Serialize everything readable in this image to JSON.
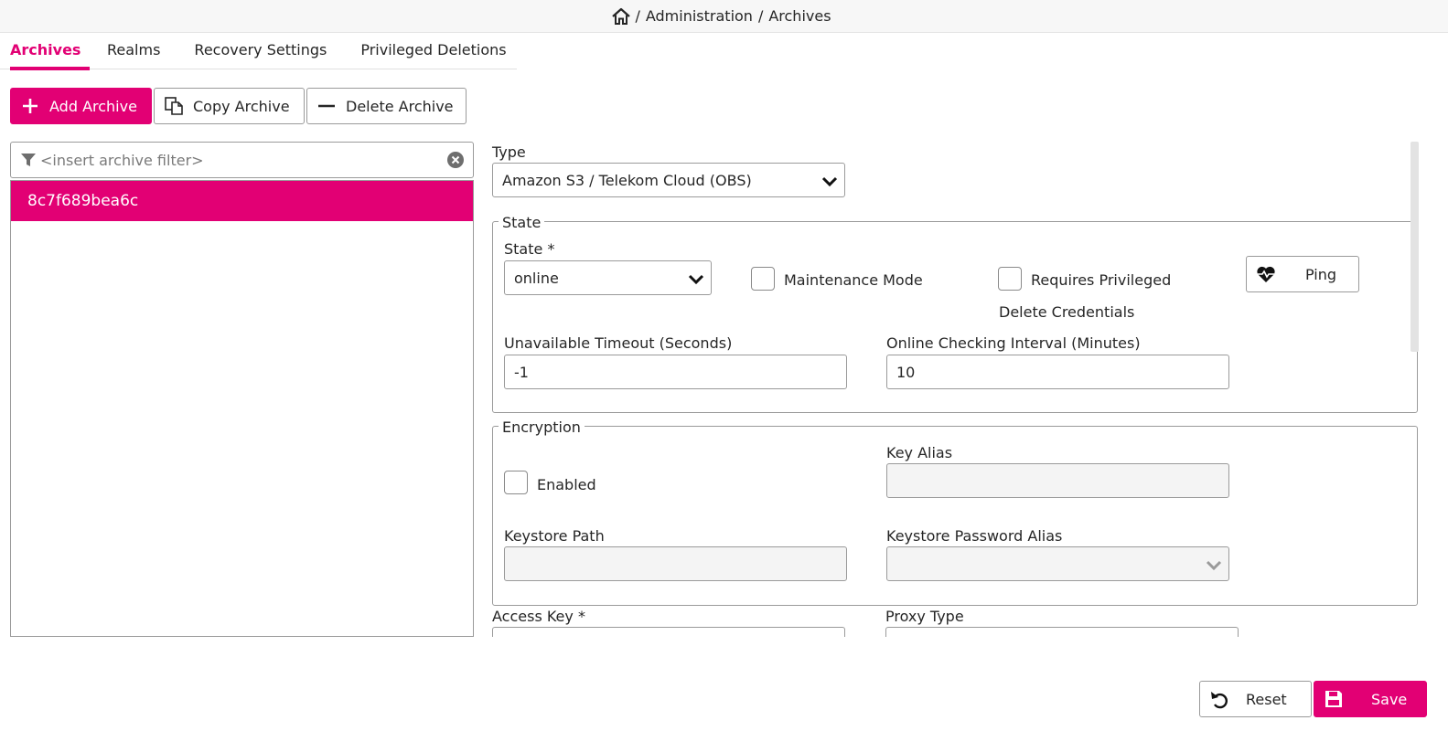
{
  "breadcrumb": {
    "home_icon": "home-icon",
    "separator": "/",
    "items": [
      "Administration",
      "Archives"
    ]
  },
  "tabs": [
    {
      "label": "Archives",
      "active": true
    },
    {
      "label": "Realms",
      "active": false
    },
    {
      "label": "Recovery Settings",
      "active": false
    },
    {
      "label": "Privileged Deletions",
      "active": false
    }
  ],
  "toolbar": {
    "add_label": "Add Archive",
    "copy_label": "Copy Archive",
    "delete_label": "Delete Archive"
  },
  "filter": {
    "placeholder": "<insert archive filter>",
    "value": ""
  },
  "archives": [
    "8c7f689bea6c"
  ],
  "form": {
    "type_label": "Type",
    "type_value": "Amazon S3 / Telekom Cloud (OBS)",
    "state_section": {
      "legend": "State",
      "state_label": "State  *",
      "state_value": "online",
      "maintenance_label": "Maintenance Mode",
      "maintenance_checked": false,
      "requires_priv_line1": "Requires Privileged",
      "requires_priv_line2": "Delete Credentials",
      "requires_priv_checked": false,
      "ping_label": "Ping",
      "unavailable_timeout_label": "Unavailable Timeout (Seconds)",
      "unavailable_timeout_value": "-1",
      "online_interval_label": "Online Checking Interval (Minutes)",
      "online_interval_value": "10"
    },
    "encryption_section": {
      "legend": "Encryption",
      "enabled_label": "Enabled",
      "enabled_checked": false,
      "key_alias_label": "Key Alias",
      "key_alias_value": "",
      "keystore_path_label": "Keystore Path",
      "keystore_path_value": "",
      "keystore_password_alias_label": "Keystore Password Alias",
      "keystore_password_alias_value": ""
    },
    "access_key_label": "Access Key  *",
    "proxy_type_label": "Proxy Type"
  },
  "footer": {
    "reset_label": "Reset",
    "save_label": "Save"
  },
  "colors": {
    "accent": "#e20074",
    "border": "#9a9a9a"
  }
}
